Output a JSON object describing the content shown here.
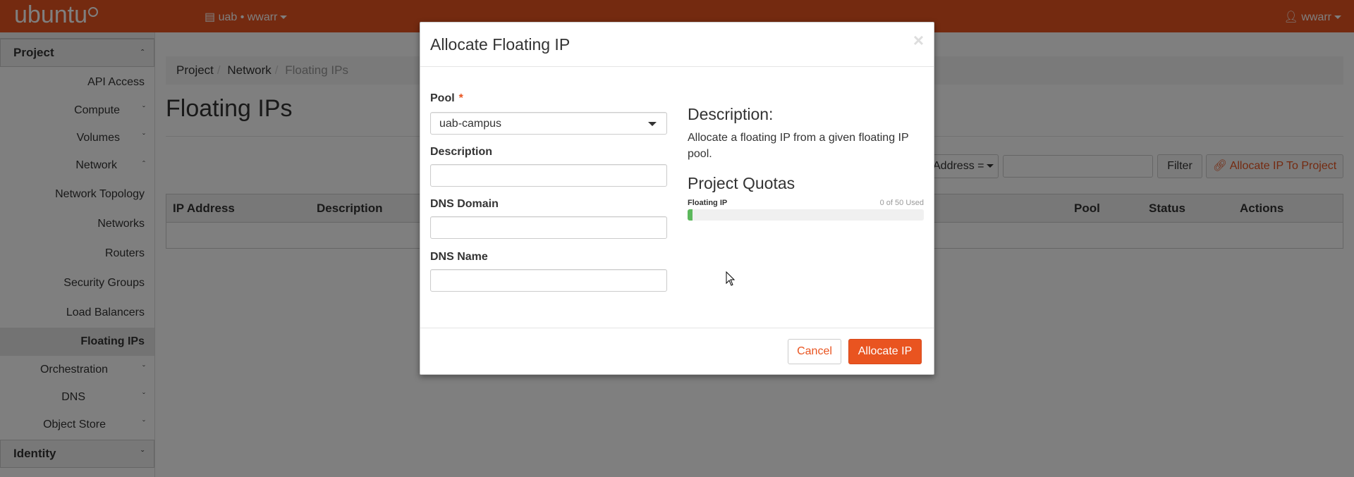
{
  "topbar": {
    "logo": "ubuntu",
    "project_switcher": "uab • wwarr",
    "user": "wwarr",
    "color": "#e95420"
  },
  "sidebar": {
    "project_group": "Project",
    "items": [
      {
        "label": "API Access"
      },
      {
        "label": "Compute"
      },
      {
        "label": "Volumes"
      },
      {
        "label": "Network"
      },
      {
        "label": "Network Topology"
      },
      {
        "label": "Networks"
      },
      {
        "label": "Routers"
      },
      {
        "label": "Security Groups"
      },
      {
        "label": "Load Balancers"
      },
      {
        "label": "Floating IPs"
      },
      {
        "label": "Orchestration"
      },
      {
        "label": "DNS"
      },
      {
        "label": "Object Store"
      }
    ],
    "identity_group": "Identity"
  },
  "breadcrumb": {
    "project": "Project",
    "network": "Network",
    "current": "Floating IPs"
  },
  "page_title": "Floating IPs",
  "toolbar": {
    "filter_select": "Address =",
    "filter_button": "Filter",
    "allocate_to_project": "Allocate IP To Project"
  },
  "table": {
    "headers": [
      "IP Address",
      "Description",
      "Pool",
      "Status",
      "Actions"
    ]
  },
  "modal": {
    "title": "Allocate Floating IP",
    "pool_label": "Pool",
    "pool_value": "uab-campus",
    "description_label": "Description",
    "dns_domain_label": "DNS Domain",
    "dns_name_label": "DNS Name",
    "help_heading": "Description:",
    "help_text": "Allocate a floating IP from a given floating IP pool.",
    "quotas_heading": "Project Quotas",
    "quota": {
      "label": "Floating IP",
      "used_text": "0 of 50 Used",
      "used": 0,
      "total": 50
    },
    "cancel": "Cancel",
    "allocate": "Allocate IP"
  }
}
